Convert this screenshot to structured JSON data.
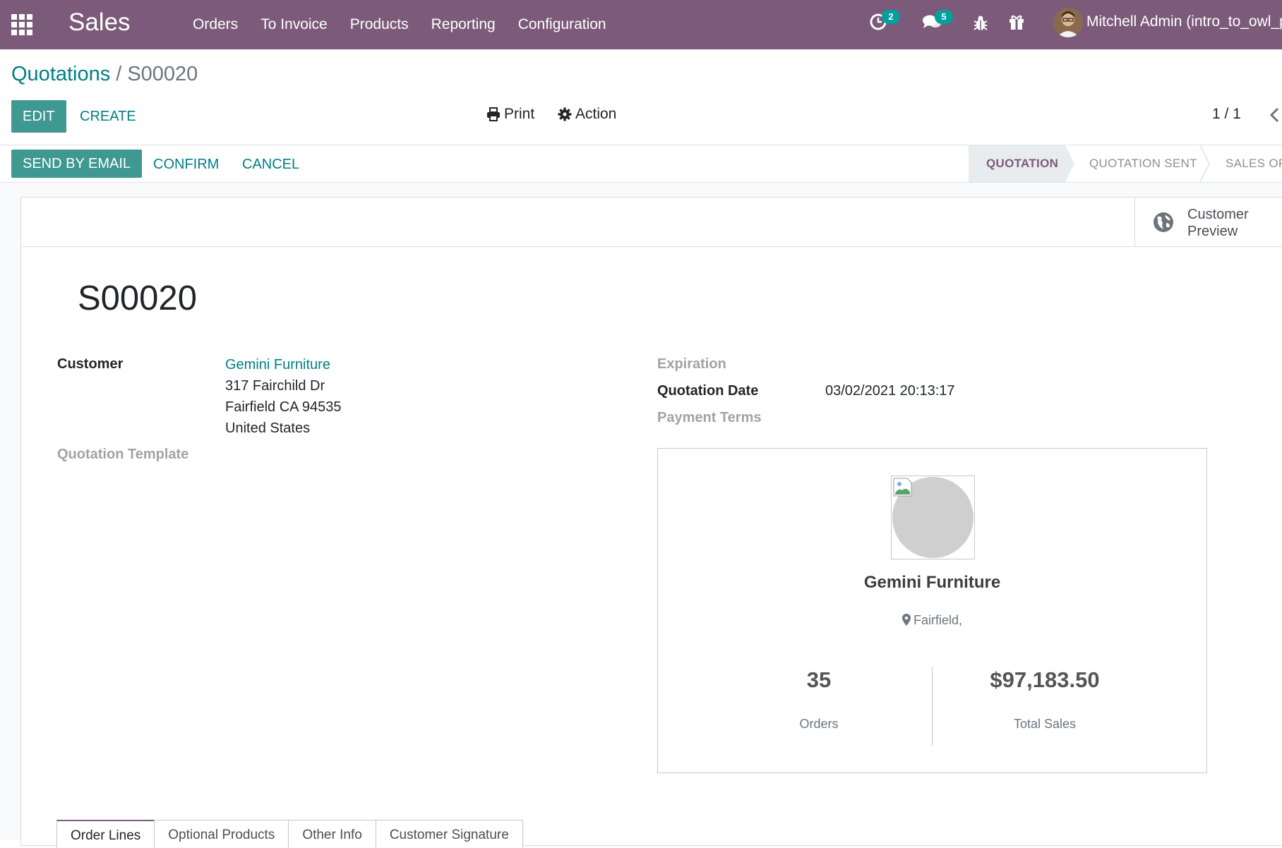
{
  "navbar": {
    "brand": "Sales",
    "menu": [
      "Orders",
      "To Invoice",
      "Products",
      "Reporting",
      "Configuration"
    ],
    "activity_count": "2",
    "messages_count": "5",
    "user_name": "Mitchell Admin (intro_to_owl_p"
  },
  "breadcrumb": {
    "parent": "Quotations",
    "separator": "/",
    "current": "S00020"
  },
  "control_panel": {
    "edit_label": "EDIT",
    "create_label": "CREATE",
    "print_label": "Print",
    "action_label": "Action",
    "pager": "1 / 1"
  },
  "statusbar": {
    "buttons": {
      "send_email": "SEND BY EMAIL",
      "confirm": "CONFIRM",
      "cancel": "CANCEL"
    },
    "stages": [
      "QUOTATION",
      "QUOTATION SENT",
      "SALES OR"
    ],
    "active_stage": "QUOTATION"
  },
  "button_box": {
    "customer_preview": "Customer Preview"
  },
  "form": {
    "title": "S00020",
    "customer_label": "Customer",
    "customer_name": "Gemini Furniture",
    "address": [
      "317 Fairchild Dr",
      "Fairfield CA 94535",
      "United States"
    ],
    "quotation_template_label": "Quotation Template",
    "expiration_label": "Expiration",
    "quotation_date_label": "Quotation Date",
    "quotation_date_value": "03/02/2021 20:13:17",
    "payment_terms_label": "Payment Terms"
  },
  "partner_card": {
    "name": "Gemini Furniture",
    "location": "Fairfield,",
    "orders_value": "35",
    "orders_label": "Orders",
    "sales_value": "$97,183.50",
    "sales_label": "Total Sales"
  },
  "tabs": [
    "Order Lines",
    "Optional Products",
    "Other Info",
    "Customer Signature"
  ],
  "colors": {
    "navbar": "#7c5b7a",
    "primary": "#3f9891",
    "link": "#017e84",
    "badge": "#00a09d"
  }
}
